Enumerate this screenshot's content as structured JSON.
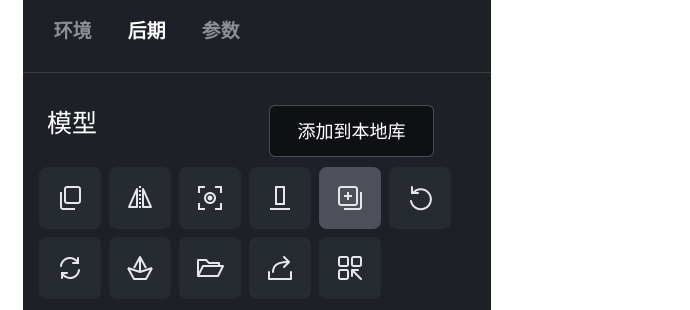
{
  "tabs": [
    {
      "label": "环境",
      "active": false
    },
    {
      "label": "后期",
      "active": true
    },
    {
      "label": "参数",
      "active": false
    }
  ],
  "section": {
    "title": "模型"
  },
  "tooltip": {
    "text": "添加到本地库"
  },
  "tools": [
    {
      "icon": "layers-icon",
      "active": false
    },
    {
      "icon": "mirror-flip-icon",
      "active": false
    },
    {
      "icon": "focus-target-icon",
      "active": false
    },
    {
      "icon": "align-bottom-icon",
      "active": false
    },
    {
      "icon": "add-to-library-icon",
      "active": true
    },
    {
      "icon": "rotate-ccw-icon",
      "active": false
    },
    {
      "icon": "refresh-icon",
      "active": false
    },
    {
      "icon": "boat-icon",
      "active": false
    },
    {
      "icon": "folder-open-icon",
      "active": false
    },
    {
      "icon": "share-export-icon",
      "active": false
    },
    {
      "icon": "qr-scan-icon",
      "active": false
    }
  ],
  "colors": {
    "panel": "#1d2026",
    "tile": "#262a31",
    "tile_active": "#4d5058",
    "icon": "#e6e7ea"
  }
}
